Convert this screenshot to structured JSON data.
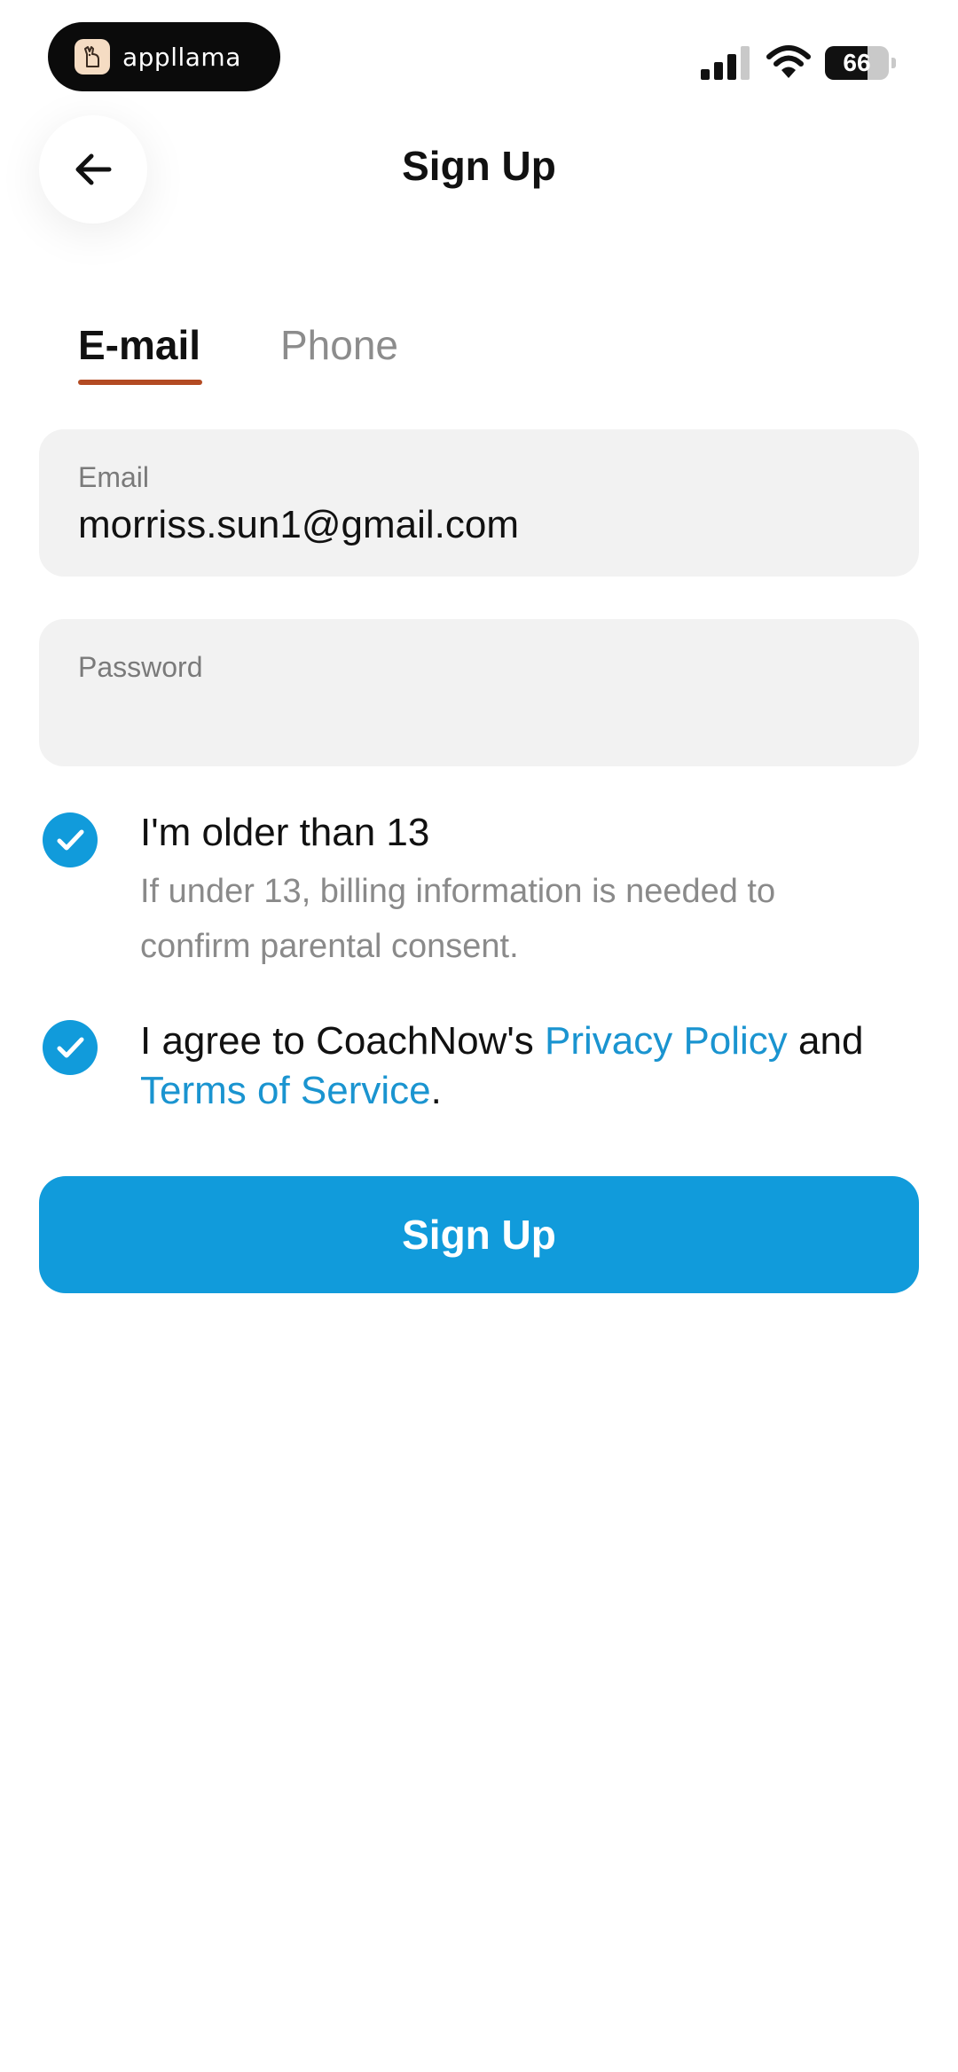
{
  "status_bar": {
    "app_name": "appllama",
    "battery": "66",
    "battery_level_percent": 66,
    "icons": [
      "llama-logo-icon",
      "signal-icon",
      "wifi-icon",
      "battery-icon"
    ]
  },
  "header": {
    "title": "Sign Up",
    "back_icon": "arrow-left-icon"
  },
  "tabs": [
    {
      "label": "E-mail",
      "selected": true
    },
    {
      "label": "Phone",
      "selected": false
    }
  ],
  "form": {
    "email": {
      "label": "Email",
      "value": "morriss.sun1@gmail.com"
    },
    "password": {
      "label": "Password",
      "value": ""
    }
  },
  "checks": {
    "age": {
      "checked": true,
      "title": "I'm older than 13",
      "subtitle": "If under 13, billing information is needed to confirm parental consent."
    },
    "terms": {
      "checked": true,
      "prefix": "I agree to CoachNow's ",
      "privacy_link": "Privacy Policy",
      "middle": " and",
      "terms_link": "Terms of Service",
      "suffix": "."
    }
  },
  "signup_button": "Sign Up",
  "colors": {
    "accent": "#119bdb",
    "link": "#1a94d0",
    "tab_underline": "#b34b23",
    "field_bg": "#f2f2f2"
  }
}
